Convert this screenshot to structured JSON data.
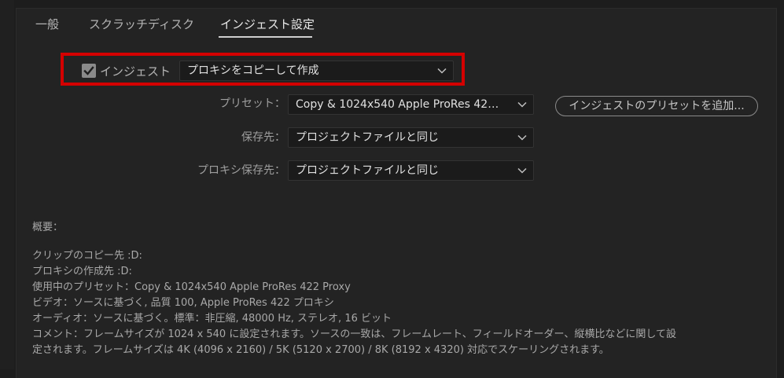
{
  "tabs": [
    {
      "label": "一般"
    },
    {
      "label": "スクラッチディスク"
    },
    {
      "label": "インジェスト設定"
    }
  ],
  "ingest": {
    "label": "インジェスト",
    "checked": true,
    "mode": "プロキシをコピーして作成"
  },
  "preset": {
    "label": "プリセット：",
    "value": "Copy & 1024x540 Apple ProRes 422 Proxy",
    "add_button": "インジェストのプリセットを追加..."
  },
  "destination": {
    "label": "保存先：",
    "value": "プロジェクトファイルと同じ"
  },
  "proxy_destination": {
    "label": "プロキシ保存先：",
    "value": "プロジェクトファイルと同じ"
  },
  "summary": {
    "heading": "概要：",
    "lines": [
      "クリップのコピー先 :D:",
      "プロキシの作成先 :D:",
      "使用中のプリセット：Copy & 1024x540 Apple ProRes 422 Proxy",
      "ビデオ：ソースに基づく, 品質 100, Apple ProRes 422 プロキシ",
      "オーディオ：ソースに基づく。標準：非圧縮, 48000 Hz, ステレオ, 16 ビット",
      "コメント：フレームサイズが 1024 x 540 に設定されます。ソースの一致は、フレームレート、フィールドオーダー、縦横比などに関して設",
      "定されます。フレームサイズは 4K (4096 x 2160) / 5K (5120 x 2700) / 8K (8192 x 4320) 対応でスケーリングされます。"
    ]
  },
  "colors": {
    "highlight": "#d40000",
    "panel_bg": "#232323",
    "field_bg": "#1b1b1b"
  }
}
